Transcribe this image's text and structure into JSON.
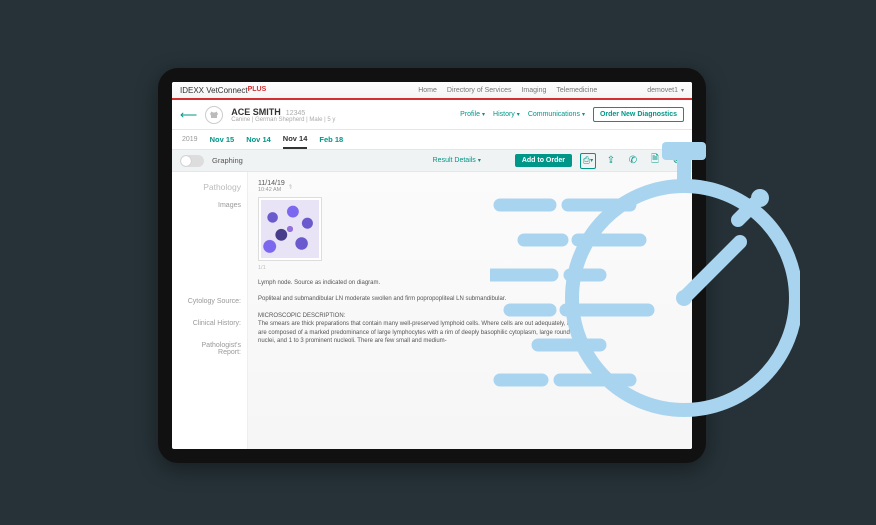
{
  "brand": {
    "name": "IDEXX VetConnect",
    "suffix": "PLUS"
  },
  "topnav": {
    "items": [
      "Home",
      "Directory of Services",
      "Imaging",
      "Telemedicine"
    ],
    "user": "demovet1"
  },
  "patient": {
    "name": "ACE SMITH",
    "id": "12345",
    "species": "Canine",
    "breed": "German Shepherd",
    "sex": "Male",
    "age": "5 y"
  },
  "patient_menu": {
    "profile": "Profile",
    "history": "History",
    "communications": "Communications",
    "order_btn": "Order New Diagnostics"
  },
  "tabs": {
    "year": "2019",
    "items": [
      "Nov 15",
      "Nov 14",
      "Nov 14",
      "Feb 18"
    ],
    "active_index": 2
  },
  "toolbar": {
    "graphing": "Graphing",
    "result_details": "Result Details",
    "add_to_order": "Add to Order"
  },
  "pathology": {
    "section_title": "Pathology",
    "labels": {
      "images": "Images",
      "cytology_source": "Cytology Source:",
      "clinical_history": "Clinical History:",
      "pathologist_report": "Pathologist's Report:"
    },
    "timestamp_date": "11/14/19",
    "timestamp_time": "10:42 AM",
    "image_caption": "1/1",
    "cytology_source": "Lymph node. Source as indicated on diagram.",
    "clinical_history": "Popliteal and submandibular LN moderate swollen and firm popropopliteal LN submandibular.",
    "report_title": "MICROSCOPIC DESCRIPTION:",
    "report_body": "The smears are thick preparations that contain many well-preserved lymphoid cells. Where cells are out adequately, these are composed of a marked predominance of large lymphocytes with a rim of deeply basophilic cytoplasm, large round nuclei, and 1 to 3 prominent nucleoli. There are few small and medium-"
  }
}
